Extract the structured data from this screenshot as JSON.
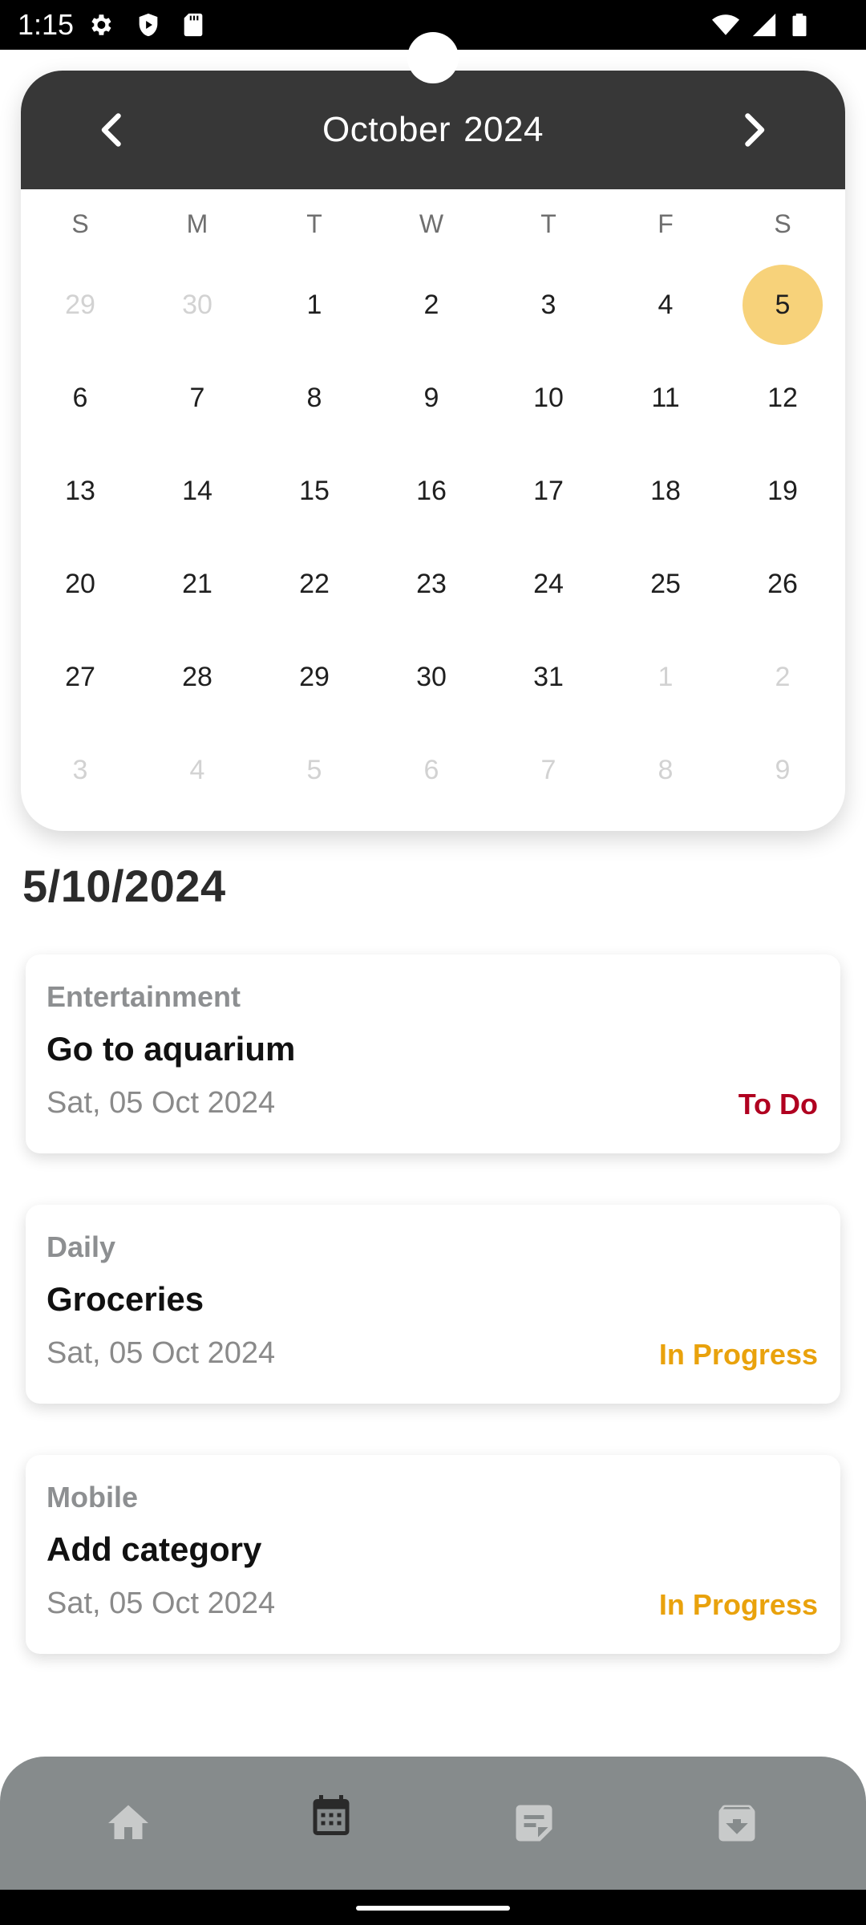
{
  "status_bar": {
    "time": "1:15"
  },
  "calendar": {
    "month": "October",
    "year": "2024",
    "weekdays": [
      "S",
      "M",
      "T",
      "W",
      "T",
      "F",
      "S"
    ],
    "weeks": [
      [
        "29",
        "30",
        "1",
        "2",
        "3",
        "4",
        "5"
      ],
      [
        "6",
        "7",
        "8",
        "9",
        "10",
        "11",
        "12"
      ],
      [
        "13",
        "14",
        "15",
        "16",
        "17",
        "18",
        "19"
      ],
      [
        "20",
        "21",
        "22",
        "23",
        "24",
        "25",
        "26"
      ],
      [
        "27",
        "28",
        "29",
        "30",
        "31",
        "1",
        "2"
      ],
      [
        "3",
        "4",
        "5",
        "6",
        "7",
        "8",
        "9"
      ]
    ],
    "muted": [
      [
        0,
        0
      ],
      [
        0,
        1
      ],
      [
        4,
        5
      ],
      [
        4,
        6
      ],
      [
        5,
        0
      ],
      [
        5,
        1
      ],
      [
        5,
        2
      ],
      [
        5,
        3
      ],
      [
        5,
        4
      ],
      [
        5,
        5
      ],
      [
        5,
        6
      ]
    ],
    "selected": [
      0,
      6
    ],
    "selected_color": "#f7d27a",
    "header_color": "#373737"
  },
  "selected_date": "5/10/2024",
  "tasks": [
    {
      "category": "Entertainment",
      "title": "Go to aquarium",
      "date": "Sat, 05 Oct 2024",
      "status": "To Do",
      "status_color": "#b00020"
    },
    {
      "category": "Daily",
      "title": "Groceries",
      "date": "Sat, 05 Oct 2024",
      "status": "In Progress",
      "status_color": "#e9a20c"
    },
    {
      "category": "Mobile",
      "title": "Add category",
      "date": "Sat, 05 Oct 2024",
      "status": "In Progress",
      "status_color": "#e9a20c"
    }
  ],
  "bottom_nav": {
    "items": [
      {
        "icon": "home-icon",
        "active": false
      },
      {
        "icon": "calendar-icon",
        "active": true
      },
      {
        "icon": "notes-icon",
        "active": false
      },
      {
        "icon": "archive-icon",
        "active": false
      }
    ],
    "background": "#868b8c"
  }
}
